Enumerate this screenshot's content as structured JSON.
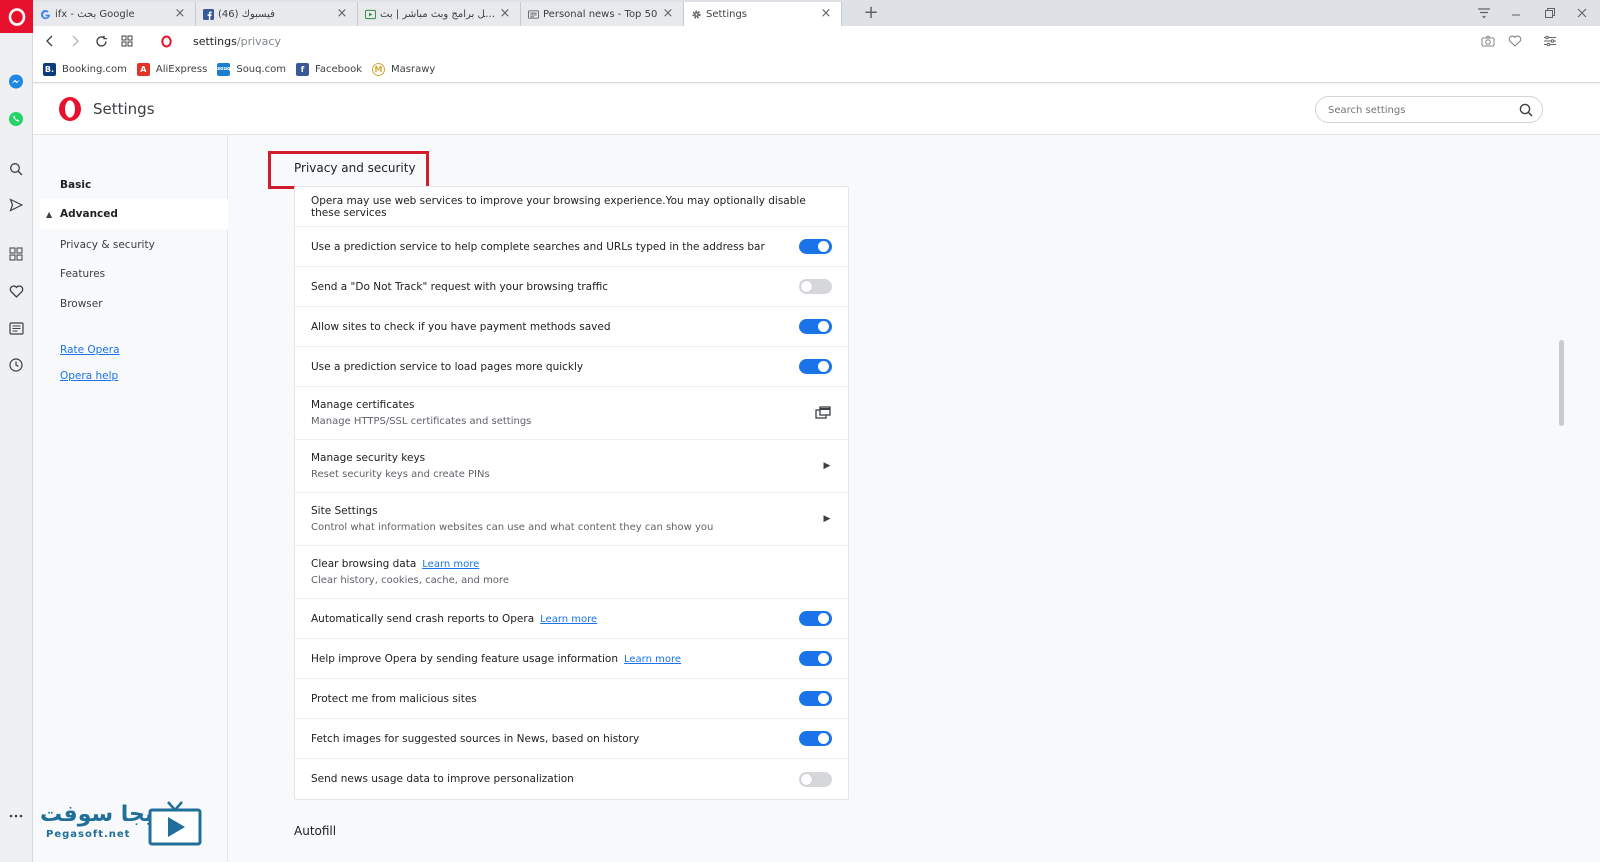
{
  "tabs": [
    {
      "title": "ifx - بحث Google",
      "favicon": "google-icon",
      "active": false
    },
    {
      "title": "(46) فيسبوك",
      "favicon": "facebook-icon",
      "active": false
    },
    {
      "title": "تحميل برامج وبث مباشر | بث",
      "favicon": "video-icon",
      "active": false
    },
    {
      "title": "Personal news - Top 50",
      "favicon": "news-icon",
      "active": false
    },
    {
      "title": "Settings",
      "favicon": "gear-icon",
      "active": true
    }
  ],
  "address": {
    "host": "settings",
    "path": "/privacy"
  },
  "bookmarks": [
    {
      "label": "Booking.com",
      "icon": "B.",
      "color": "#0c3b7c"
    },
    {
      "label": "AliExpress",
      "icon": "A",
      "color": "#e43225"
    },
    {
      "label": "Souq.com",
      "icon": "souq",
      "color": "#1b7fd0"
    },
    {
      "label": "Facebook",
      "icon": "f",
      "color": "#3b5998"
    },
    {
      "label": "Masrawy",
      "icon": "M",
      "color": "#d8a637"
    }
  ],
  "header": {
    "title": "Settings",
    "search_placeholder": "Search settings"
  },
  "nav": {
    "basic": "Basic",
    "advanced": "Advanced",
    "items": [
      "Privacy & security",
      "Features",
      "Browser"
    ],
    "links": [
      "Rate Opera",
      "Opera help"
    ]
  },
  "section": {
    "title": "Privacy and security",
    "intro": "Opera may use web services to improve your browsing experience.You may optionally disable these services",
    "rows": [
      {
        "label": "Use a prediction service to help complete searches and URLs typed in the address bar",
        "control": "toggle",
        "on": true
      },
      {
        "label": "Send a \"Do Not Track\" request with your browsing traffic",
        "control": "toggle",
        "on": false
      },
      {
        "label": "Allow sites to check if you have payment methods saved",
        "control": "toggle",
        "on": true
      },
      {
        "label": "Use a prediction service to load pages more quickly",
        "control": "toggle",
        "on": true
      },
      {
        "label": "Manage certificates",
        "sub": "Manage HTTPS/SSL certificates and settings",
        "control": "external"
      },
      {
        "label": "Manage security keys",
        "sub": "Reset security keys and create PINs",
        "control": "arrow"
      },
      {
        "label": "Site Settings",
        "sub": "Control what information websites can use and what content they can show you",
        "control": "arrow"
      },
      {
        "label": "Clear browsing data",
        "learn": "Learn more",
        "sub": "Clear history, cookies, cache, and more",
        "control": "none"
      },
      {
        "label": "Automatically send crash reports to Opera",
        "learn": "Learn more",
        "control": "toggle",
        "on": true
      },
      {
        "label": "Help improve Opera by sending feature usage information",
        "learn": "Learn more",
        "control": "toggle",
        "on": true
      },
      {
        "label": "Protect me from malicious sites",
        "control": "toggle",
        "on": true
      },
      {
        "label": "Fetch images for suggested sources in News, based on history",
        "control": "toggle",
        "on": true
      },
      {
        "label": "Send news usage data to improve personalization",
        "control": "toggle",
        "on": false
      }
    ]
  },
  "next_section": "Autofill",
  "watermark": {
    "arabic": "بيجا سوفت",
    "english": "Pegasoft.net"
  },
  "colors": {
    "accent": "#1a73e8",
    "opera_red": "#e8112d",
    "highlight": "#d01e2e"
  }
}
